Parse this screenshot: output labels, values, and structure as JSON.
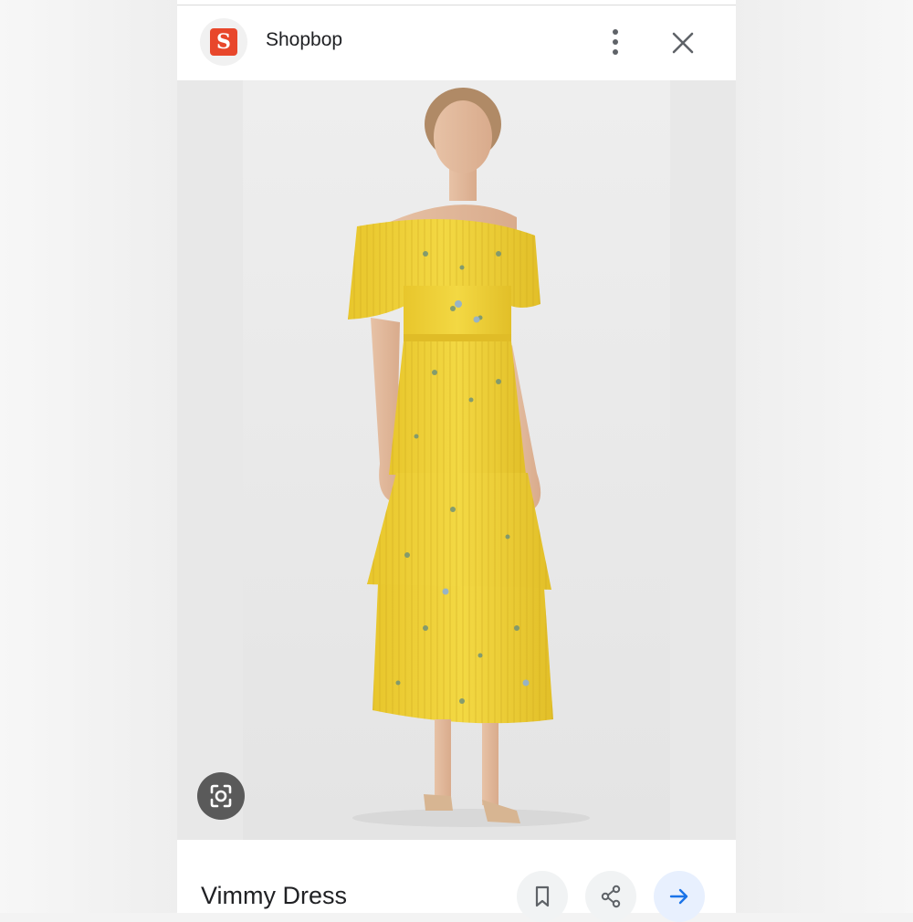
{
  "header": {
    "favicon_letter": "S",
    "site_name": "Shopbop",
    "favicon_color": "#e8472b"
  },
  "result": {
    "title": "Vimmy Dress"
  },
  "icons": {
    "favicon": "shopbop-logo",
    "more": "more-vert-icon",
    "close": "close-icon",
    "lens": "google-lens-icon",
    "bookmark": "bookmark-icon",
    "share": "share-icon",
    "visit": "arrow-right-icon"
  },
  "colors": {
    "dress": "#f0d23c",
    "accent": "#1a73e8"
  }
}
